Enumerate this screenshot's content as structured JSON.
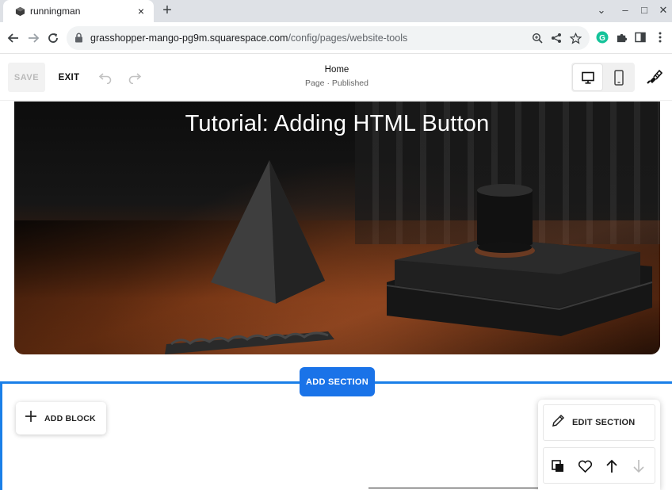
{
  "browser": {
    "tab": {
      "title": "runningman",
      "close_symbol": "×"
    },
    "new_tab_symbol": "+",
    "window_controls": {
      "list": "⌄",
      "minimize": "–",
      "maximize": "□",
      "close": "✕"
    },
    "url": {
      "host": "grasshopper-mango-pg9m.squarespace.com",
      "path": "/config/pages/website-tools"
    },
    "extension_badge_letter": "G"
  },
  "editor": {
    "save_label": "SAVE",
    "exit_label": "EXIT",
    "page_title": "Home",
    "page_status": "Page · Published",
    "active_device": "desktop"
  },
  "hero": {
    "title": "Tutorial: Adding HTML Button"
  },
  "section": {
    "add_section_label": "ADD SECTION",
    "add_block_label": "ADD BLOCK",
    "edit_section_label": "EDIT SECTION"
  },
  "colors": {
    "accent": "#1a73e8",
    "frame": "#1a7fe8",
    "grammarly": "#15c39a"
  },
  "icons": {
    "nav": [
      "back-arrow-icon",
      "forward-arrow-icon",
      "reload-icon"
    ],
    "omnibox": [
      "zoom-icon",
      "share-icon",
      "bookmark-star-icon"
    ],
    "extensions": [
      "grammarly-icon",
      "puzzle-icon",
      "side-panel-icon",
      "kebab-menu-icon"
    ],
    "editor": [
      "undo-icon",
      "redo-icon",
      "desktop-icon",
      "mobile-icon",
      "paintbrush-icon"
    ],
    "section_tools": [
      "duplicate-icon",
      "heart-icon",
      "arrow-up-icon",
      "arrow-down-icon"
    ]
  }
}
